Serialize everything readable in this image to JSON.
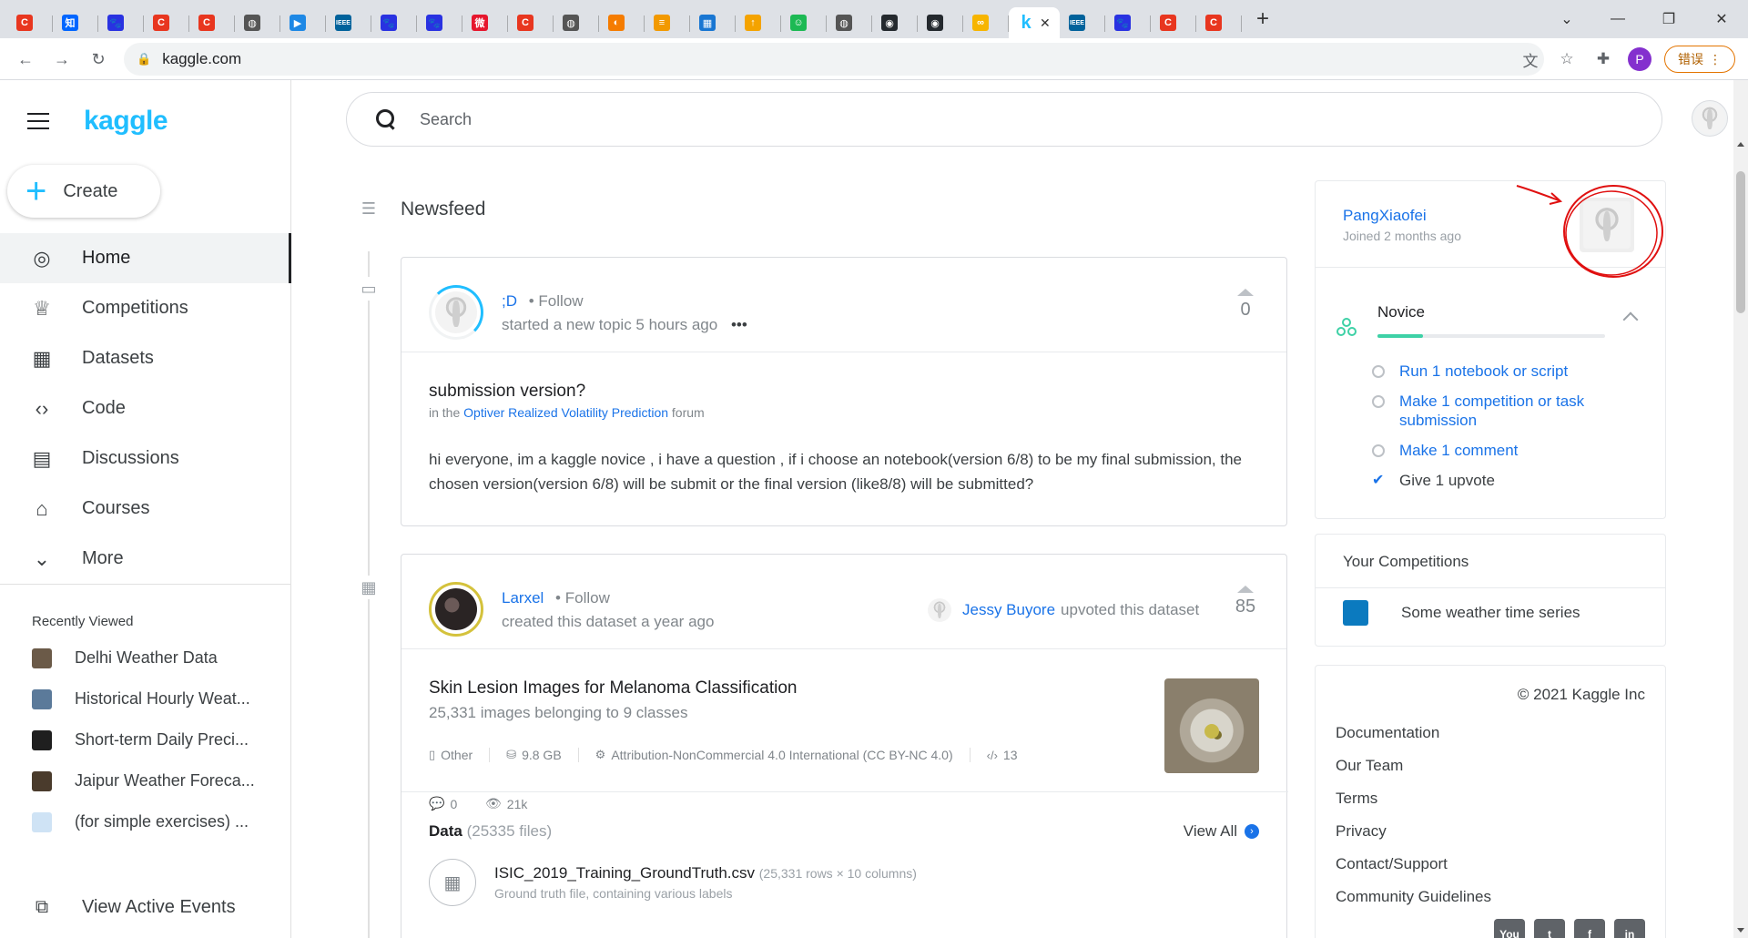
{
  "browser": {
    "url": "kaggle.com",
    "error_button": "错误",
    "profile_initial": "P",
    "tabs": [
      {
        "icon": "C",
        "color": "#e8361f"
      },
      {
        "icon": "知",
        "color": "#0066ff"
      },
      {
        "icon": "🐾",
        "color": "#2932e1"
      },
      {
        "icon": "C",
        "color": "#e8361f"
      },
      {
        "icon": "C",
        "color": "#e8361f"
      },
      {
        "icon": "◍",
        "color": "#555555"
      },
      {
        "icon": "▶",
        "color": "#1e88e5"
      },
      {
        "icon": "IEEE",
        "color": "#00629b"
      },
      {
        "icon": "🐾",
        "color": "#2932e1"
      },
      {
        "icon": "🐾",
        "color": "#2932e1"
      },
      {
        "icon": "微",
        "color": "#e6162d"
      },
      {
        "icon": "C",
        "color": "#e8361f"
      },
      {
        "icon": "◍",
        "color": "#555555"
      },
      {
        "icon": "◐",
        "color": "#f57c00"
      },
      {
        "icon": "≡",
        "color": "#f29900"
      },
      {
        "icon": "▦",
        "color": "#1976d2"
      },
      {
        "icon": "↑",
        "color": "#f4a300"
      },
      {
        "icon": "☺",
        "color": "#1db954"
      },
      {
        "icon": "◍",
        "color": "#555555"
      },
      {
        "icon": "◉",
        "color": "#24292e"
      },
      {
        "icon": "◉",
        "color": "#24292e"
      },
      {
        "icon": "∞",
        "color": "#f7b500"
      },
      {
        "icon": "k",
        "color": "#20beff",
        "active": true
      },
      {
        "icon": "IEEE",
        "color": "#00629b"
      },
      {
        "icon": "🐾",
        "color": "#2932e1"
      },
      {
        "icon": "C",
        "color": "#e8361f"
      },
      {
        "icon": "C",
        "color": "#e8361f"
      }
    ]
  },
  "sidebar": {
    "logo": "kaggle",
    "create_label": "Create",
    "nav": [
      {
        "label": "Home",
        "icon": "◎",
        "active": true
      },
      {
        "label": "Competitions",
        "icon": "♕"
      },
      {
        "label": "Datasets",
        "icon": "▦"
      },
      {
        "label": "Code",
        "icon": "‹›"
      },
      {
        "label": "Discussions",
        "icon": "▤"
      },
      {
        "label": "Courses",
        "icon": "⌂"
      },
      {
        "label": "More",
        "icon": "⌄"
      }
    ],
    "recently_viewed_title": "Recently Viewed",
    "recently_viewed": [
      {
        "label": "Delhi Weather Data",
        "color": "#6b5a48"
      },
      {
        "label": "Historical Hourly Weat...",
        "color": "#5b7a9a"
      },
      {
        "label": "Short-term Daily Preci...",
        "color": "#1f1f1f"
      },
      {
        "label": "Jaipur Weather Foreca...",
        "color": "#4a3b2c"
      },
      {
        "label": "(for simple exercises) ...",
        "color": "#cfe3f5"
      }
    ],
    "active_events_label": "View Active Events"
  },
  "search": {
    "placeholder": "Search"
  },
  "feed": {
    "title": "Newsfeed",
    "post": {
      "author": ";D",
      "follow": "Follow",
      "action": "started a new topic 5 hours ago",
      "votes": "0",
      "title": "submission version?",
      "forum_prefix": "in the",
      "forum_link": "Optiver Realized Volatility Prediction",
      "forum_suffix": "forum",
      "body": "hi everyone, im a kaggle novice , i have a question , if i choose an notebook(version 6/8) to be my final submission, the chosen version(version 6/8) will be submit or the final version (like8/8)   will be submitted?"
    },
    "dataset": {
      "author": "Larxel",
      "follow": "Follow",
      "action": "created this dataset a year ago",
      "upvoter_name": "Jessy Buyore",
      "upvoter_action": "upvoted this dataset",
      "votes": "85",
      "title": "Skin Lesion Images for Melanoma Classification",
      "subtitle": "25,331 images belonging to 9 classes",
      "meta": [
        {
          "icon": "▯",
          "label": "Other"
        },
        {
          "icon": "⛁",
          "label": "9.8 GB"
        },
        {
          "icon": "⚙",
          "label": "Attribution-NonCommercial 4.0 International (CC BY-NC 4.0)"
        },
        {
          "icon": "‹/›",
          "label": "13"
        }
      ],
      "comments": "0",
      "views": "21k",
      "data_label": "Data",
      "data_count": "(25335 files)",
      "view_all": "View All",
      "files": [
        {
          "name": "ISIC_2019_Training_GroundTruth.csv",
          "detail": "(25,331 rows × 10 columns)",
          "desc": "Ground truth file, containing various labels"
        }
      ]
    }
  },
  "profile": {
    "name": "PangXiaofei",
    "joined": "Joined 2 months ago",
    "tier": "Novice",
    "tier_progress": 0.2,
    "tasks": [
      {
        "label": "Run 1 notebook or script",
        "done": false
      },
      {
        "label": "Make 1 competition or task submission",
        "done": false
      },
      {
        "label": "Make 1 comment",
        "done": false
      },
      {
        "label": "Give 1 upvote",
        "done": true
      }
    ]
  },
  "competitions": {
    "title": "Your Competitions",
    "items": [
      {
        "label": "Some weather time series",
        "color": "#0b7abf"
      }
    ]
  },
  "footer": {
    "copyright": "© 2021 Kaggle Inc",
    "links": [
      "Documentation",
      "Our Team",
      "Terms",
      "Privacy",
      "Contact/Support",
      "Community Guidelines"
    ],
    "socials": [
      "You",
      "t",
      "f",
      "in"
    ]
  }
}
